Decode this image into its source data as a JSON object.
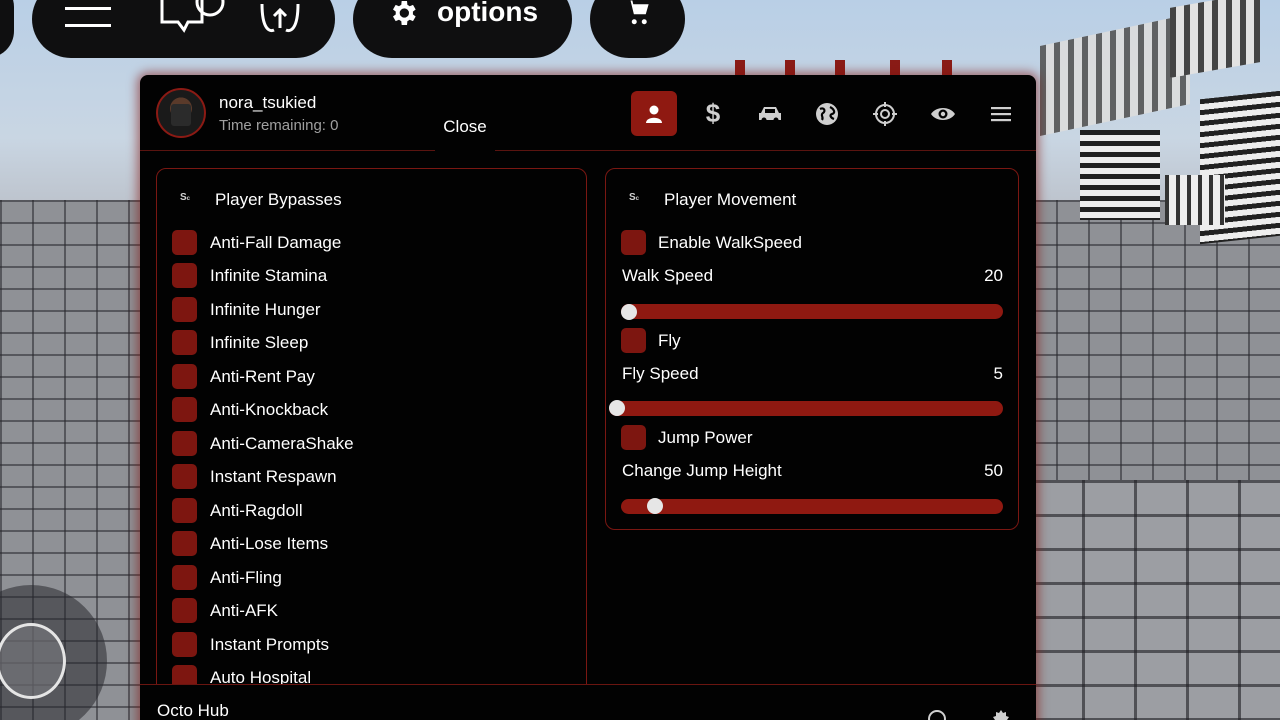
{
  "topbar": {
    "options_label": "options"
  },
  "user": {
    "name": "nora_tsukied",
    "time_remaining": "Time remaining: 0"
  },
  "close_label": "Close",
  "nav": {
    "active_index": 0,
    "items": [
      {
        "icon": "person-icon"
      },
      {
        "icon": "dollar-icon",
        "glyph": "$"
      },
      {
        "icon": "car-icon"
      },
      {
        "icon": "globe-icon"
      },
      {
        "icon": "crosshair-icon"
      },
      {
        "icon": "eye-icon"
      },
      {
        "icon": "menu-icon"
      }
    ]
  },
  "player_bypasses": {
    "title": "Player Bypasses",
    "items": [
      "Anti-Fall Damage",
      "Infinite Stamina",
      "Infinite Hunger",
      "Infinite Sleep",
      "Anti-Rent Pay",
      "Anti-Knockback",
      "Anti-CameraShake",
      "Instant Respawn",
      "Anti-Ragdoll",
      "Anti-Lose Items",
      "Anti-Fling",
      "Anti-AFK",
      "Instant Prompts",
      "Auto Hospital"
    ]
  },
  "player_movement": {
    "title": "Player Movement",
    "enable_walkspeed": "Enable WalkSpeed",
    "walk_speed_label": "Walk Speed",
    "walk_speed_value": "20",
    "walk_speed_fraction": 0.0,
    "fly": "Fly",
    "fly_speed_label": "Fly Speed",
    "fly_speed_value": "5",
    "fly_speed_fraction": 0.0,
    "jump_power": "Jump Power",
    "jump_height_label": "Change Jump Height",
    "jump_height_value": "50",
    "jump_height_fraction": 0.07
  },
  "footer": {
    "title": "Octo Hub"
  },
  "colors": {
    "accent": "#8f1911",
    "background": "#020202",
    "border": "#7a1712"
  }
}
